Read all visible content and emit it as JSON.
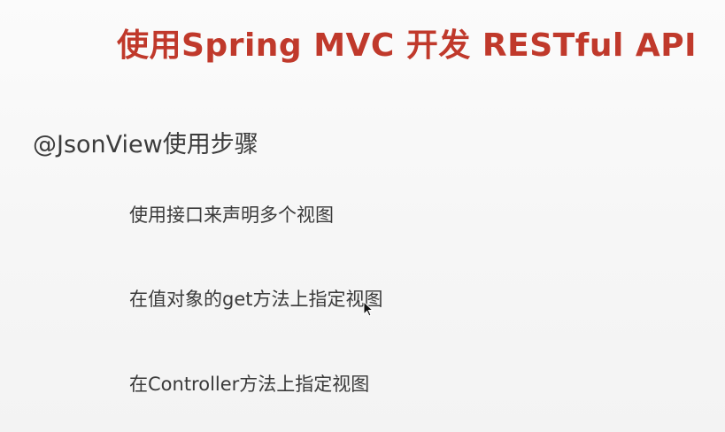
{
  "slide": {
    "title": "使用Spring MVC 开发 RESTful API",
    "subheading": "@JsonView使用步骤",
    "steps": [
      "使用接口来声明多个视图",
      "在值对象的get方法上指定视图",
      "在Controller方法上指定视图"
    ],
    "colors": {
      "title": "#c0392b",
      "text": "#3a3a3a",
      "background": "#f7f7f7"
    },
    "icons": {
      "cursor": "mouse-pointer-icon"
    }
  }
}
